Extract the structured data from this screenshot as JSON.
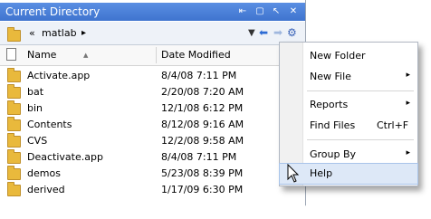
{
  "window": {
    "title": "Current Directory",
    "controls": [
      "undock-icon",
      "minimize-icon",
      "maximize-icon",
      "close-icon"
    ]
  },
  "address": {
    "prefix": "«",
    "path": "matlab",
    "arrow": "▸"
  },
  "columns": {
    "name": "Name",
    "date": "Date Modified",
    "sort_indicator": "▲"
  },
  "files": [
    {
      "name": "Activate.app",
      "date": "8/4/08 7:11 PM"
    },
    {
      "name": "bat",
      "date": "2/20/08 7:20 AM"
    },
    {
      "name": "bin",
      "date": "12/1/08 6:12 PM"
    },
    {
      "name": "Contents",
      "date": "8/12/08 9:16 AM"
    },
    {
      "name": "CVS",
      "date": "12/2/08 9:58 AM"
    },
    {
      "name": "Deactivate.app",
      "date": "8/4/08 7:11 PM"
    },
    {
      "name": "demos",
      "date": "5/23/08 8:39 PM"
    },
    {
      "name": "derived",
      "date": "1/17/09 6:30 PM"
    }
  ],
  "menu": {
    "new_folder": "New Folder",
    "new_file": "New File",
    "reports": "Reports",
    "find_files": "Find Files",
    "find_files_shortcut": "Ctrl+F",
    "group_by": "Group By",
    "help": "Help",
    "submenu_arrow": "▸"
  },
  "colors": {
    "titlebar": "#4a80d8",
    "folder": "#e9b93c",
    "highlight": "#dde8f7"
  }
}
